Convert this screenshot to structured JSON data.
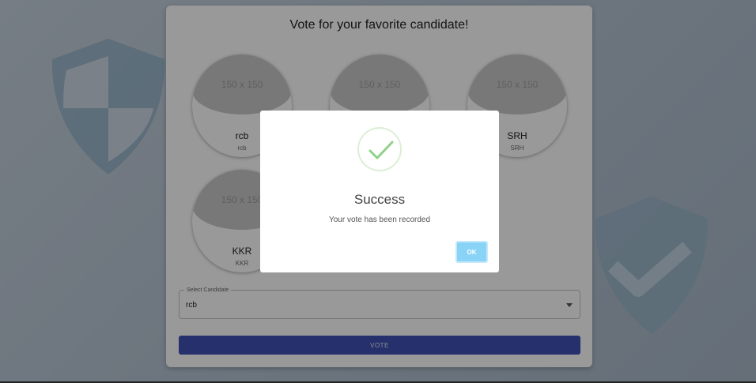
{
  "page": {
    "title": "Vote for your favorite candidate!"
  },
  "candidates": [
    {
      "name": "rcb",
      "sub": "rcb",
      "placeholder": "150 x 150"
    },
    {
      "name": "",
      "sub": "",
      "placeholder": "150 x 150"
    },
    {
      "name": "SRH",
      "sub": "SRH",
      "placeholder": "150 x 150"
    },
    {
      "name": "KKR",
      "sub": "KKR",
      "placeholder": "150 x 150"
    }
  ],
  "form": {
    "select_label": "Select Candidate",
    "select_value": "rcb",
    "vote_label": "VOTE"
  },
  "dialog": {
    "icon": "checkmark-icon",
    "title": "Success",
    "message": "Your vote has been recorded",
    "ok_label": "OK"
  },
  "colors": {
    "primary": "#3f51b5",
    "ok_button": "#89d3f6",
    "success_check": "#8fd18a",
    "background_shield": "#7fa6c3"
  }
}
